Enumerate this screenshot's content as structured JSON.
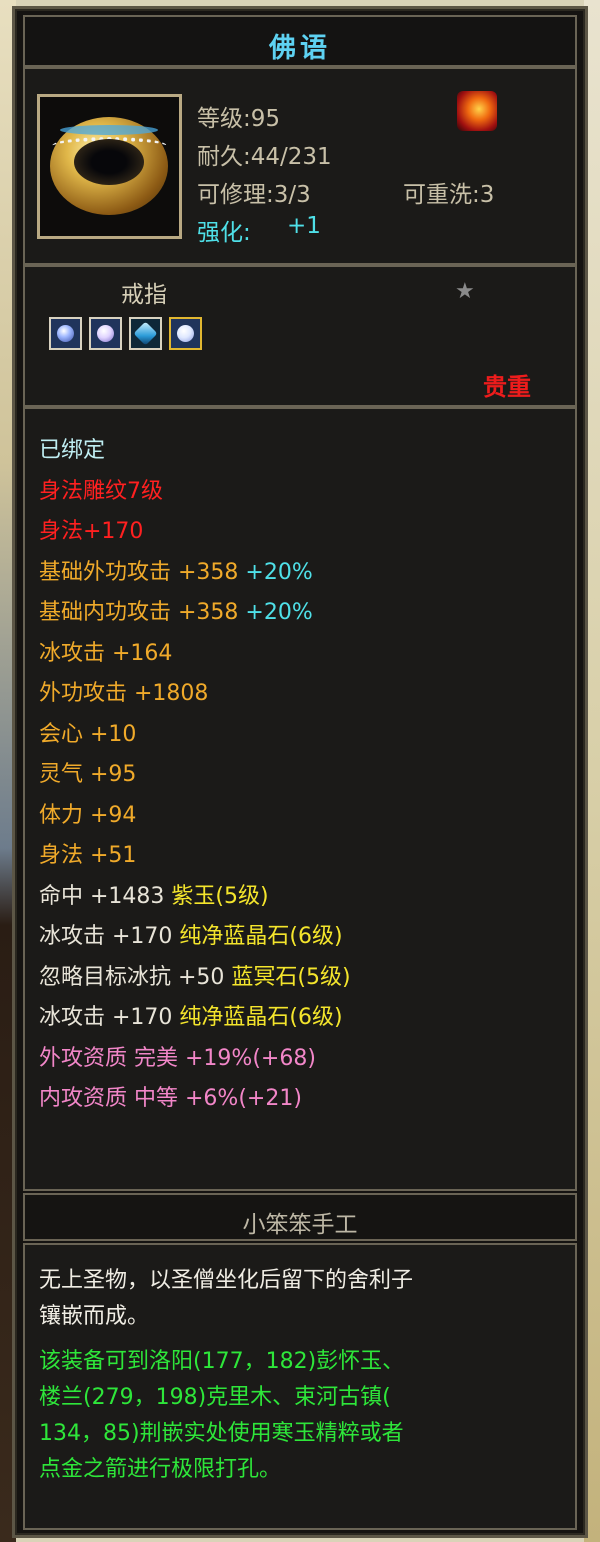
{
  "item": {
    "name": "佛语",
    "level": "等级:95",
    "durability": "耐久:44/231",
    "repairable": "可修理:3/3",
    "rewashable": "可重洗:3",
    "enhance_label": "强化:",
    "enhance_value": "+1",
    "type": "戒指",
    "rarity": "贵重",
    "gems": [
      "gem-slot-1",
      "gem-slot-2",
      "gem-slot-3",
      "gem-slot-4"
    ]
  },
  "attributes": {
    "bound": "已绑定",
    "carving": "身法雕纹7级",
    "carving_bonus": "身法+170",
    "base_ext_atk": "基础外功攻击 +358",
    "base_ext_atk_pct": "+20%",
    "base_int_atk": "基础内功攻击 +358",
    "base_int_atk_pct": "+20%",
    "ice_atk": "冰攻击 +164",
    "ext_atk": "外功攻击 +1808",
    "crit": "会心 +10",
    "spirit": "灵气 +95",
    "stamina": "体力 +94",
    "agility": "身法 +51",
    "gem_line_1": "命中 +1483",
    "gem_name_1": "紫玉(5级)",
    "gem_line_2": "冰攻击 +170",
    "gem_name_2": "纯净蓝晶石(6级)",
    "gem_line_3": "忽略目标冰抗 +50",
    "gem_name_3": "蓝冥石(5级)",
    "gem_line_4": "冰攻击 +170",
    "gem_name_4": "纯净蓝晶石(6级)",
    "quality_ext": "外攻资质  完美 +19%(+68)",
    "quality_int": "内攻资质  中等 +6%(+21)"
  },
  "maker": "小笨笨手工",
  "description": {
    "line1": "无上圣物，以圣僧坐化后留下的舍利子",
    "line2": "镶嵌而成。",
    "line3": "该装备可到洛阳(177，182)彭怀玉、",
    "line4": "楼兰(279，198)克里木、束河古镇(",
    "line5": "134，85)荆嵌实处使用寒玉精粹或者",
    "line6": "点金之箭进行极限打孔。"
  },
  "colors": {
    "title": "#5ed2f2",
    "precious": "#ee1c1c",
    "attribute_orange": "#f0aa2a",
    "gem_yellow": "#f4e52c",
    "quality_pink": "#f286c8",
    "desc_green": "#2ee63a"
  }
}
